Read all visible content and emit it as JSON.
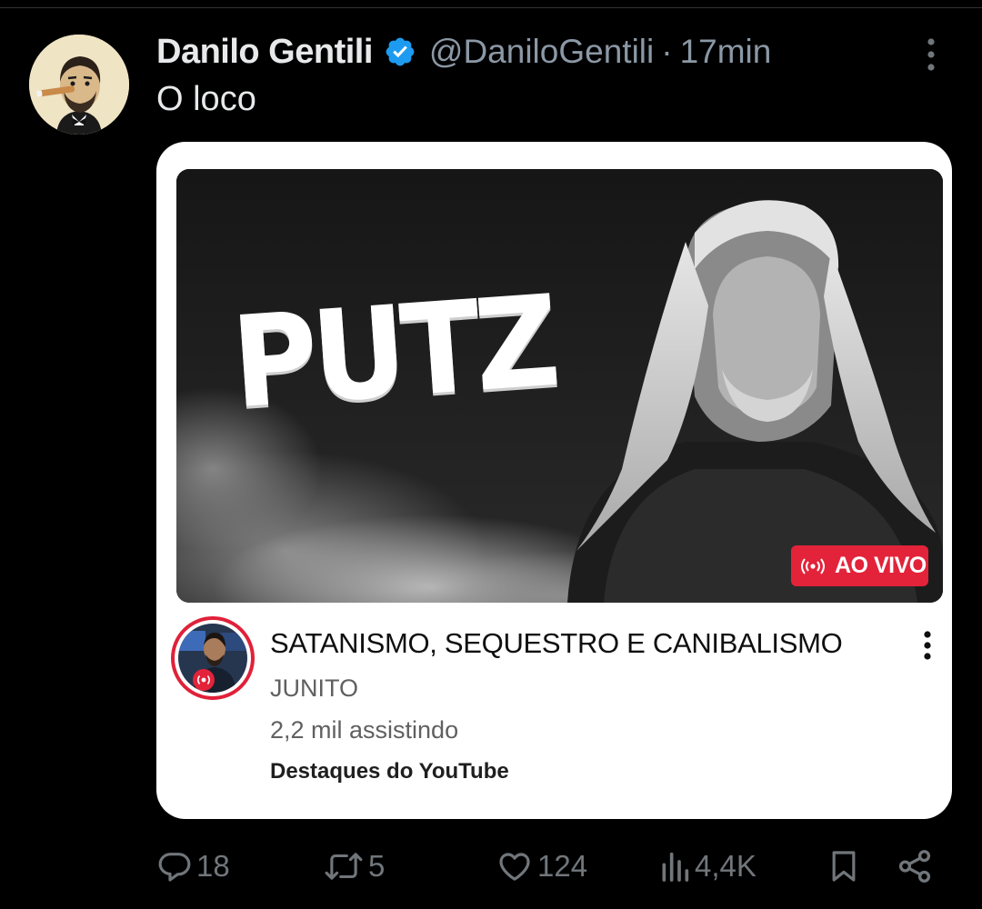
{
  "post": {
    "author_name": "Danilo Gentili",
    "handle": "@DaniloGentili",
    "separator": "·",
    "time": "17min",
    "text": "O loco",
    "verified": true
  },
  "card": {
    "thumbnail_title": "PUTZ",
    "live_badge": "AO VIVO",
    "video_title": "SATANISMO, SEQUESTRO E CANIBALISMO",
    "channel_name": "JUNITO",
    "viewers": "2,2 mil assistindo",
    "source": "Destaques do YouTube"
  },
  "actions": {
    "replies": "18",
    "reposts": "5",
    "likes": "124",
    "views": "4,4K"
  },
  "icons": {
    "verified": "verified-badge-icon",
    "more": "more-vertical-icon",
    "live": "live-broadcast-icon",
    "reply": "reply-icon",
    "repost": "repost-icon",
    "like": "heart-icon",
    "views": "views-chart-icon",
    "bookmark": "bookmark-icon",
    "share": "share-icon"
  },
  "colors": {
    "background": "#000000",
    "text_primary": "#e7e9ea",
    "text_secondary": "#8b98a5",
    "verified_blue": "#1d9bf0",
    "live_red": "#e3233a"
  }
}
